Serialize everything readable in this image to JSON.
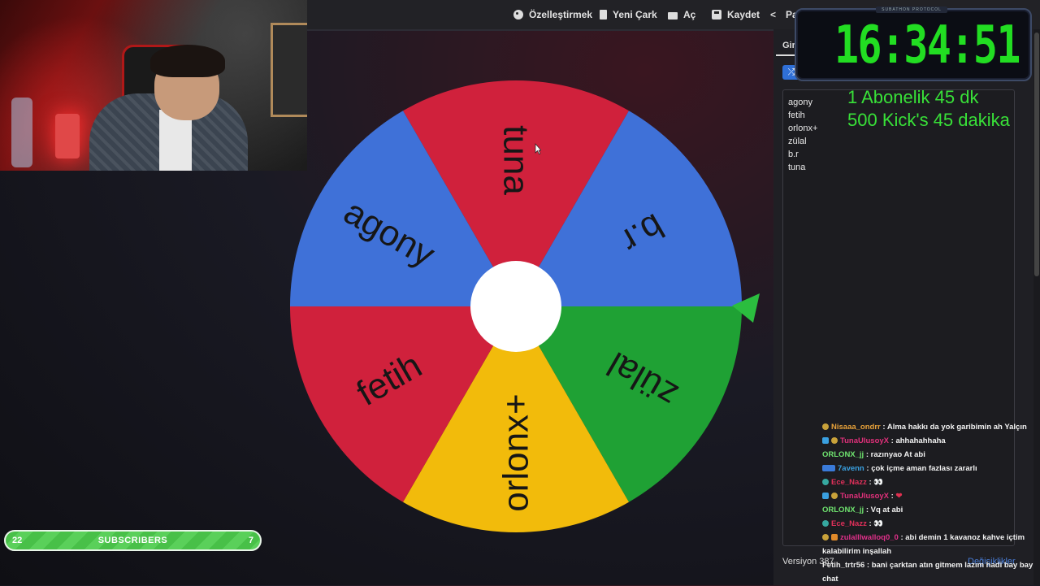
{
  "toolbar": {
    "customize": "Özelleştirmek",
    "new_wheel": "Yeni Çark",
    "open": "Aç",
    "save": "Kaydet",
    "share": "Pa"
  },
  "wheel": {
    "segments": [
      {
        "label": "tuna",
        "color": "#d0213c"
      },
      {
        "label": "b.r",
        "color": "#3f71d8"
      },
      {
        "label": "zülal",
        "color": "#1fa134"
      },
      {
        "label": "orlonx+",
        "color": "#f2bb0b"
      },
      {
        "label": "fetih",
        "color": "#d0213c"
      },
      {
        "label": "agony",
        "color": "#3f71d8"
      }
    ],
    "pointer_color": "#2bbd3f"
  },
  "panel": {
    "tab_label": "Gir",
    "shuffle_icon": "shuffle-icon",
    "entries": [
      "agony",
      "fetih",
      "orlonx+",
      "zülal",
      "b.r",
      "tuna"
    ],
    "version": "Versiyon 387",
    "changes_link": "Değişiklikler"
  },
  "timer": {
    "header": "SUBATHON PROTOCOL",
    "value": "16:34:51",
    "color": "#22dd22"
  },
  "notes": {
    "line1": "1 Abonelik 45 dk",
    "line2": "500 Kick's 45 dakika"
  },
  "chat": [
    {
      "user": "Nisaaa_ondrr",
      "color": "#e8a23a",
      "text": "Alma hakkı da yok garibimin ah Yalçın"
    },
    {
      "user": "TunaUlusoyX",
      "color": "#e0307a",
      "text": "ahhahahhaha"
    },
    {
      "user": "ORLONX_jj",
      "color": "#6fe36f",
      "text": "razınyao At abi"
    },
    {
      "user": "7avenn",
      "color": "#3aa0e0",
      "text": "çok içme aman fazlası zararlı"
    },
    {
      "user": "Ece_Nazz",
      "color": "#e0305a",
      "text": "👀"
    },
    {
      "user": "TunaUlusoyX",
      "color": "#e0307a",
      "text": "❤"
    },
    {
      "user": "ORLONX_jj",
      "color": "#6fe36f",
      "text": "Vq at abi"
    },
    {
      "user": "Ece_Nazz",
      "color": "#e0305a",
      "text": "👀"
    },
    {
      "user": "zulalllwalloq0_0",
      "color": "#e0308a",
      "text": "abi demin 1 kavanoz kahve içtim kalabilirim inşallah"
    },
    {
      "user": "Fetih_trtr56",
      "color": "#e8e8e8",
      "text": "bani çarktan atın gitmem lazım hadi bay bay chat"
    }
  ],
  "subscribers": {
    "current": "22",
    "label": "SUBSCRIBERS",
    "goal": "7"
  }
}
